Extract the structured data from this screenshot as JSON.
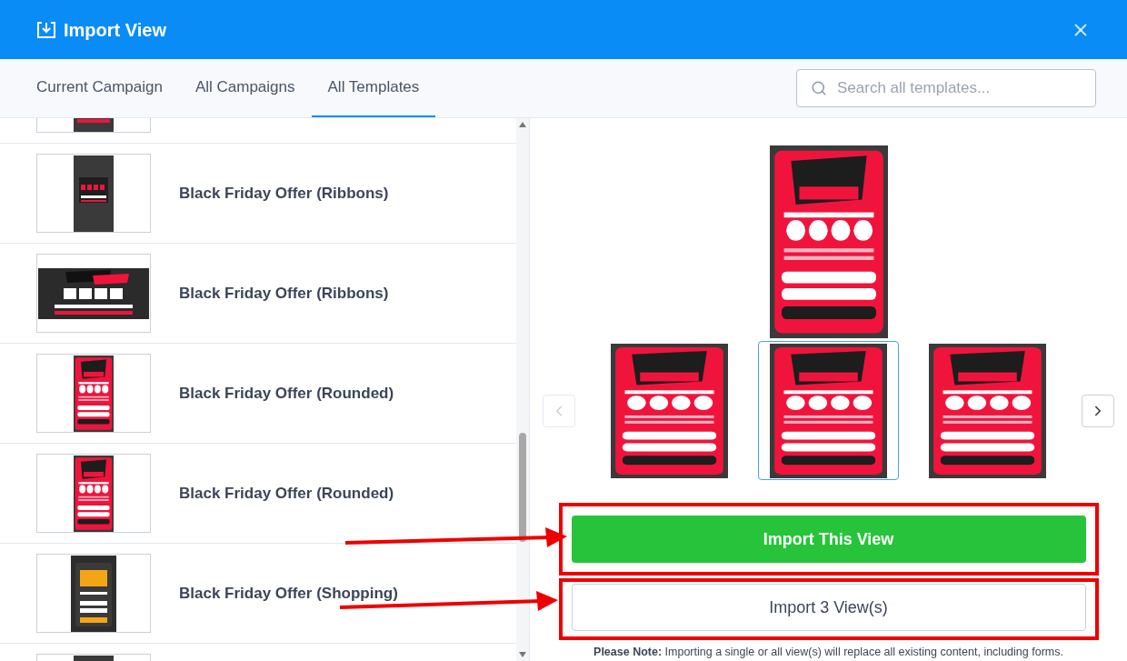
{
  "window": {
    "title": "Import View"
  },
  "tabs": [
    {
      "label": "Current Campaign",
      "selected": false
    },
    {
      "label": "All Campaigns",
      "selected": false
    },
    {
      "label": "All Templates",
      "selected": true
    }
  ],
  "search": {
    "placeholder": "Search all templates..."
  },
  "templates": [
    {
      "kind": "partial"
    },
    {
      "kind": "ribbon",
      "title": "Black Friday Offer (Ribbons)"
    },
    {
      "kind": "banner",
      "title": "Black Friday Offer (Ribbons)"
    },
    {
      "kind": "rounded",
      "title": "Black Friday Offer (Rounded)"
    },
    {
      "kind": "rounded",
      "title": "Black Friday Offer (Rounded)"
    },
    {
      "kind": "shopping",
      "title": "Black Friday Offer (Shopping)"
    },
    {
      "kind": "partial"
    }
  ],
  "carousel": {
    "prev_disabled": true,
    "next_disabled": false,
    "slides": [
      {
        "selected": false
      },
      {
        "selected": true
      },
      {
        "selected": false
      }
    ]
  },
  "import_button": "Import This View",
  "import_all_button": "Import 3 View(s)",
  "note": "**Please Note:** Importing a single or all view(s) will replace all existing content, including forms."
}
